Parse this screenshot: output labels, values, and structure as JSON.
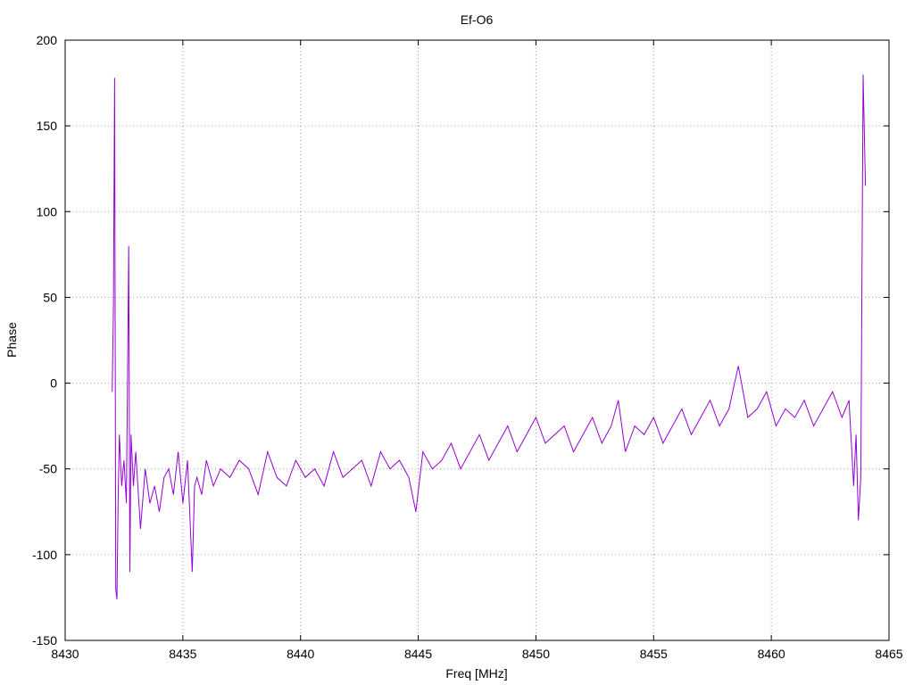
{
  "chart_data": {
    "type": "line",
    "title": "Ef-O6",
    "xlabel": "Freq [MHz]",
    "ylabel": "Phase",
    "xlim": [
      8430,
      8465
    ],
    "ylim": [
      -150,
      200
    ],
    "x_ticks": [
      8430,
      8435,
      8440,
      8445,
      8450,
      8455,
      8460,
      8465
    ],
    "y_ticks": [
      -150,
      -100,
      -50,
      0,
      50,
      100,
      150,
      200
    ],
    "grid": true,
    "grid_style": "dotted",
    "series": [
      {
        "color": "#9400d3",
        "x": [
          8432.0,
          8432.05,
          8432.1,
          8432.15,
          8432.2,
          8432.25,
          8432.3,
          8432.4,
          8432.5,
          8432.6,
          8432.7,
          8432.75,
          8432.8,
          8432.9,
          8433.0,
          8433.2,
          8433.4,
          8433.6,
          8433.8,
          8434.0,
          8434.2,
          8434.4,
          8434.6,
          8434.8,
          8435.0,
          8435.2,
          8435.4,
          8435.5,
          8435.6,
          8435.8,
          8436.0,
          8436.3,
          8436.6,
          8437.0,
          8437.4,
          8437.8,
          8438.2,
          8438.6,
          8439.0,
          8439.4,
          8439.8,
          8440.2,
          8440.6,
          8441.0,
          8441.4,
          8441.8,
          8442.2,
          8442.6,
          8443.0,
          8443.4,
          8443.8,
          8444.2,
          8444.6,
          8444.9,
          8445.2,
          8445.6,
          8446.0,
          8446.4,
          8446.8,
          8447.2,
          8447.6,
          8448.0,
          8448.4,
          8448.8,
          8449.2,
          8449.6,
          8450.0,
          8450.4,
          8450.8,
          8451.2,
          8451.6,
          8452.0,
          8452.4,
          8452.8,
          8453.2,
          8453.5,
          8453.8,
          8454.2,
          8454.6,
          8455.0,
          8455.4,
          8455.8,
          8456.2,
          8456.6,
          8457.0,
          8457.4,
          8457.8,
          8458.2,
          8458.6,
          8459.0,
          8459.4,
          8459.8,
          8460.2,
          8460.6,
          8461.0,
          8461.4,
          8461.8,
          8462.2,
          8462.6,
          8463.0,
          8463.3,
          8463.5,
          8463.6,
          8463.7,
          8463.8,
          8463.9,
          8464.0
        ],
        "y": [
          -5,
          45,
          178,
          -120,
          -126,
          -70,
          -30,
          -60,
          -45,
          -70,
          80,
          -110,
          -30,
          -60,
          -40,
          -85,
          -50,
          -70,
          -60,
          -75,
          -55,
          -50,
          -65,
          -40,
          -70,
          -45,
          -110,
          -60,
          -55,
          -65,
          -45,
          -60,
          -50,
          -55,
          -45,
          -50,
          -65,
          -40,
          -55,
          -60,
          -45,
          -55,
          -50,
          -60,
          -40,
          -55,
          -50,
          -45,
          -60,
          -40,
          -50,
          -45,
          -55,
          -75,
          -40,
          -50,
          -45,
          -35,
          -50,
          -40,
          -30,
          -45,
          -35,
          -25,
          -40,
          -30,
          -20,
          -35,
          -30,
          -25,
          -40,
          -30,
          -20,
          -35,
          -25,
          -10,
          -40,
          -25,
          -30,
          -20,
          -35,
          -25,
          -15,
          -30,
          -20,
          -10,
          -25,
          -15,
          10,
          -20,
          -15,
          -5,
          -25,
          -15,
          -20,
          -10,
          -25,
          -15,
          -5,
          -20,
          -10,
          -60,
          -30,
          -80,
          -55,
          180,
          115
        ]
      }
    ]
  }
}
